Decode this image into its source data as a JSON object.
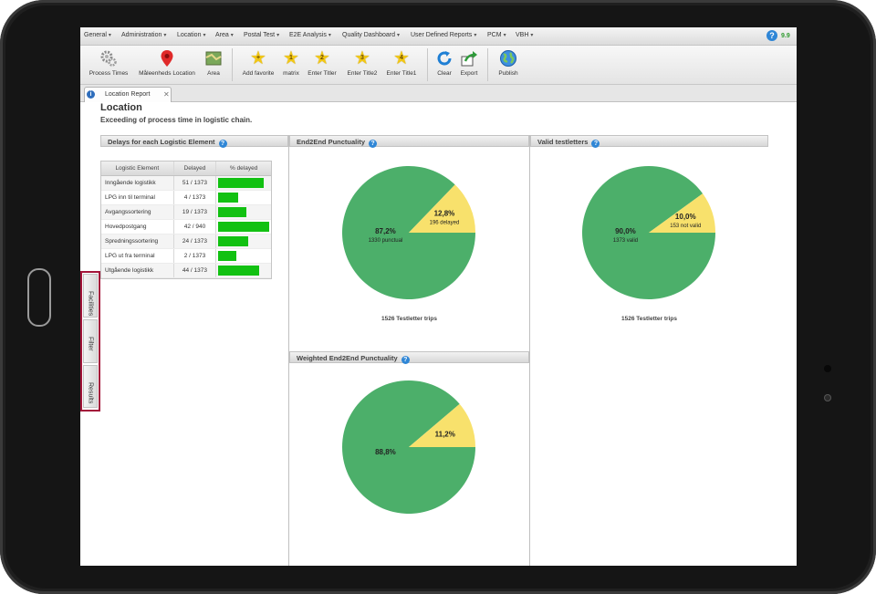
{
  "menubar": {
    "items": [
      {
        "label": "General"
      },
      {
        "label": "Administration"
      },
      {
        "label": "Location"
      },
      {
        "label": "Area"
      },
      {
        "label": "Postal Test"
      },
      {
        "label": "E2E Analysis"
      },
      {
        "label": "Quality Dashboard"
      },
      {
        "label": "User Defined Reports"
      },
      {
        "label": "PCM"
      },
      {
        "label": "VBH"
      }
    ],
    "version": "9.9"
  },
  "toolbar": {
    "buttons": [
      {
        "label": "Process Times",
        "icon": "gears-icon"
      },
      {
        "label": "Måleenheds Location",
        "icon": "map-pin-icon"
      },
      {
        "label": "Area",
        "icon": "map-icon"
      },
      {
        "label": "Add favorite",
        "icon": "star-icon",
        "num": "+"
      },
      {
        "label": "matrix",
        "icon": "star-icon",
        "num": "1"
      },
      {
        "label": "Enter Titler",
        "icon": "star-icon",
        "num": "2"
      },
      {
        "label": "Enter Title2",
        "icon": "star-icon",
        "num": "3"
      },
      {
        "label": "Enter Title1",
        "icon": "star-icon",
        "num": "4"
      },
      {
        "label": "Clear",
        "icon": "refresh-icon"
      },
      {
        "label": "Export",
        "icon": "export-icon"
      },
      {
        "label": "Publish",
        "icon": "globe-icon"
      }
    ]
  },
  "tab": {
    "label": "Location Report"
  },
  "side_tabs": [
    "Facilities",
    "Filter",
    "Results"
  ],
  "page": {
    "title": "Location",
    "subtitle": "Exceeding of process time in logistic chain."
  },
  "panels": {
    "delays": {
      "title": "Delays for each Logistic Element"
    },
    "e2e": {
      "title": "End2End Punctuality",
      "caption": "1526 Testletter trips"
    },
    "valid": {
      "title": "Valid testletters",
      "caption": "1526 Testletter trips"
    },
    "weighted": {
      "title": "Weighted End2End Punctuality"
    }
  },
  "table": {
    "headers": [
      "Logistic Element",
      "Delayed",
      "% delayed"
    ],
    "rows": [
      {
        "element": "Inngående logistikk",
        "delayed": "51 / 1373",
        "pct": 0.037
      },
      {
        "element": "LPG inn til terminal",
        "delayed": "4 / 1373",
        "pct": 0.003
      },
      {
        "element": "Avgangssortering",
        "delayed": "19 / 1373",
        "pct": 0.014
      },
      {
        "element": "Hovedpostgang",
        "delayed": "42 / 940",
        "pct": 0.045
      },
      {
        "element": "Spredningssortering",
        "delayed": "24 / 1373",
        "pct": 0.017
      },
      {
        "element": "LPG ut fra terminal",
        "delayed": "2 / 1373",
        "pct": 0.001
      },
      {
        "element": "Utgående logistikk",
        "delayed": "44 / 1373",
        "pct": 0.032
      }
    ]
  },
  "chart_data": [
    {
      "type": "pie",
      "title": "End2End Punctuality",
      "slices": [
        {
          "label": "87,2%",
          "sublabel": "1330 punctual",
          "value": 87.2,
          "color": "#4caf6a"
        },
        {
          "label": "12,8%",
          "sublabel": "196 delayed",
          "value": 12.8,
          "color": "#f8e16c"
        }
      ],
      "caption": "1526 Testletter trips"
    },
    {
      "type": "pie",
      "title": "Valid testletters",
      "slices": [
        {
          "label": "90,0%",
          "sublabel": "1373 valid",
          "value": 90.0,
          "color": "#4caf6a"
        },
        {
          "label": "10,0%",
          "sublabel": "153 not valid",
          "value": 10.0,
          "color": "#f8e16c"
        }
      ],
      "caption": "1526 Testletter trips"
    },
    {
      "type": "pie",
      "title": "Weighted End2End Punctuality",
      "slices": [
        {
          "label": "88,8%",
          "sublabel": "",
          "value": 88.8,
          "color": "#4caf6a"
        },
        {
          "label": "11,2%",
          "sublabel": "",
          "value": 11.2,
          "color": "#f8e16c"
        }
      ],
      "caption": ""
    }
  ]
}
